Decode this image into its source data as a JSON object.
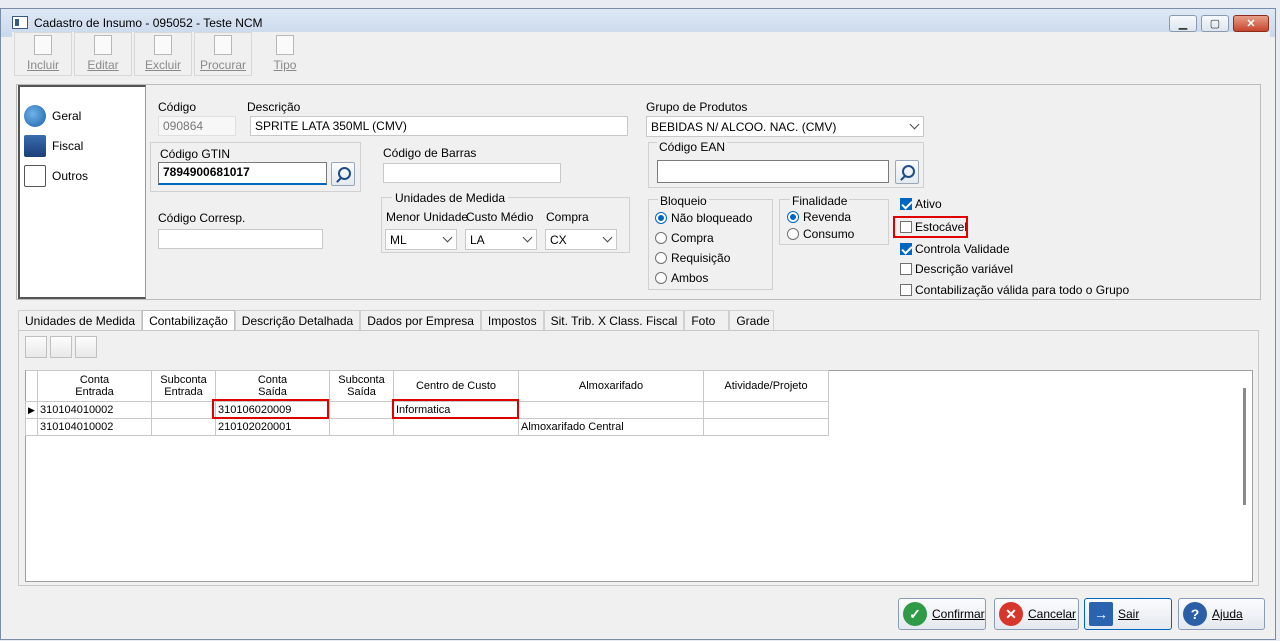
{
  "window": {
    "title": "Cadastro de Insumo - 095052 - Teste NCM"
  },
  "toolbar": {
    "incluir": "Incluir",
    "editar": "Editar",
    "excluir": "Excluir",
    "procurar": "Procurar",
    "tipo": "Tipo"
  },
  "nav": {
    "geral": "Geral",
    "fiscal": "Fiscal",
    "outros": "Outros"
  },
  "form": {
    "codigo_label": "Código",
    "codigo_value": "090864",
    "descricao_label": "Descrição",
    "descricao_value": "SPRITE LATA 350ML (CMV)",
    "grupo_label": "Grupo de Produtos",
    "grupo_value": "BEBIDAS N/ ALCOO. NAC. (CMV)",
    "gtin_label": "Código GTIN",
    "gtin_value": "7894900681017",
    "barras_label": "Código de Barras",
    "barras_value": "",
    "ean_label": "Código EAN",
    "ean_value": "",
    "corresp_label": "Código Corresp.",
    "corresp_value": "",
    "unidades_title": "Unidades de Medida",
    "menor_label": "Menor Unidade",
    "menor_value": "ML",
    "custo_label": "Custo Médio",
    "custo_value": "LA",
    "compra_label": "Compra",
    "compra_value": "CX",
    "bloqueio_title": "Bloqueio",
    "bloqueio_options": [
      "Não bloqueado",
      "Compra",
      "Requisição",
      "Ambos"
    ],
    "bloqueio_selected": "Não bloqueado",
    "finalidade_title": "Finalidade",
    "finalidade_options": [
      "Revenda",
      "Consumo"
    ],
    "finalidade_selected": "Revenda",
    "checks": {
      "ativo": {
        "label": "Ativo",
        "checked": true
      },
      "estocavel": {
        "label": "Estocável",
        "checked": false
      },
      "controla": {
        "label": "Controla Validade",
        "checked": true
      },
      "descvar": {
        "label": "Descrição variável",
        "checked": false
      },
      "contab": {
        "label": "Contabilização válida para todo o Grupo",
        "checked": false
      }
    }
  },
  "tabs": [
    "Unidades de Medida",
    "Contabilização",
    "Descrição Detalhada",
    "Dados por Empresa",
    "Impostos",
    "Sit. Trib. X Class. Fiscal",
    "Foto",
    "Grade"
  ],
  "active_tab": "Contabilização",
  "grid": {
    "headers": [
      [
        "Conta",
        "Entrada"
      ],
      [
        "Subconta",
        "Entrada"
      ],
      [
        "Conta",
        "Saída"
      ],
      [
        "Subconta",
        "Saída"
      ],
      [
        "Centro de Custo",
        ""
      ],
      [
        "Almoxarifado",
        ""
      ],
      [
        "Atividade/Projeto",
        ""
      ]
    ],
    "rows": [
      [
        "310104010002",
        "",
        "310106020009",
        "",
        "Informatica",
        "",
        ""
      ],
      [
        "310104010002",
        "",
        "210102020001",
        "",
        "",
        "Almoxarifado Central",
        ""
      ]
    ]
  },
  "buttons": {
    "confirmar": "Confirmar",
    "cancelar": "Cancelar",
    "sair": "Sair",
    "ajuda": "Ajuda"
  },
  "colors": {
    "accent": "#0067c0",
    "highlight": "#e00000"
  }
}
